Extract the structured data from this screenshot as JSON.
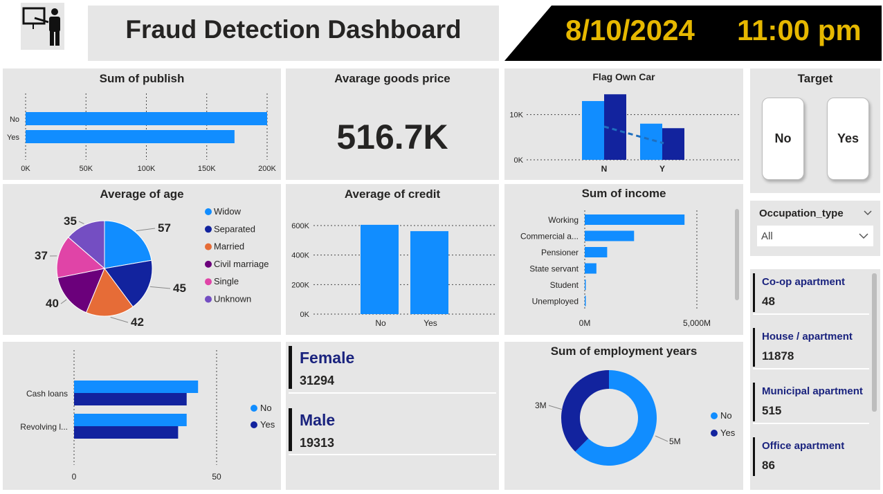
{
  "header": {
    "title": "Fraud Detection Dashboard",
    "date": "8/10/2024",
    "time": "11:00 pm",
    "icon": "presenter-icon"
  },
  "colors": {
    "light_blue": "#118DFF",
    "dark_blue": "#12239E",
    "orange": "#E66C37",
    "purple": "#6B007B",
    "pink": "#E044A7",
    "violet": "#744EC2",
    "banner_bg": "#000000",
    "banner_text": "#E6B800"
  },
  "publish_chart": {
    "title": "Sum of publish",
    "chart_data": {
      "type": "bar",
      "orientation": "horizontal",
      "categories": [
        "No",
        "Yes"
      ],
      "values": [
        200000,
        173000
      ],
      "xlim": [
        0,
        200000
      ],
      "tick_labels": [
        "0K",
        "50K",
        "100K",
        "150K",
        "200K"
      ]
    }
  },
  "goods_price": {
    "title": "Avarage goods price",
    "value": "516.7K"
  },
  "flag_car": {
    "title": "Flag Own Car",
    "chart_data": {
      "type": "bar",
      "categories": [
        "N",
        "Y"
      ],
      "series": [
        {
          "values": [
            13000,
            8000
          ]
        },
        {
          "values": [
            14500,
            7000
          ]
        }
      ],
      "ylim": [
        0,
        15000
      ],
      "tick_labels": [
        "0K",
        "10K"
      ],
      "trend_line": true
    }
  },
  "target": {
    "title": "Target",
    "buttons": [
      "No",
      "Yes"
    ]
  },
  "age_chart": {
    "title": "Average of age",
    "chart_data": {
      "type": "pie",
      "labels": [
        "Widow",
        "Separated",
        "Married",
        "Civil marriage",
        "Single",
        "Unknown"
      ],
      "values": [
        57,
        45,
        42,
        40,
        37,
        35
      ],
      "colors": [
        "#118DFF",
        "#12239E",
        "#E66C37",
        "#6B007B",
        "#E044A7",
        "#744EC2"
      ]
    }
  },
  "credit_chart": {
    "title": "Average of credit",
    "chart_data": {
      "type": "bar",
      "categories": [
        "No",
        "Yes"
      ],
      "values": [
        605000,
        562000
      ],
      "ylim": [
        0,
        600000
      ],
      "tick_labels": [
        "0K",
        "200K",
        "400K",
        "600K"
      ]
    }
  },
  "income_chart": {
    "title": "Sum of income",
    "chart_data": {
      "type": "bar",
      "orientation": "horizontal",
      "categories": [
        "Working",
        "Commercial a...",
        "Pensioner",
        "State servant",
        "Student",
        "Unemployed"
      ],
      "values": [
        4450,
        2200,
        1000,
        520,
        15,
        25
      ],
      "xlim": [
        0,
        5000
      ],
      "tick_labels": [
        "0M",
        "5,000M"
      ]
    }
  },
  "occupation_filter": {
    "label": "Occupation_type",
    "selected": "All"
  },
  "loan_chart": {
    "chart_data": {
      "type": "bar",
      "orientation": "horizontal",
      "categories": [
        "Cash loans",
        "Revolving l..."
      ],
      "series": [
        {
          "name": "No",
          "values": [
            43.5,
            39.5
          ]
        },
        {
          "name": "Yes",
          "values": [
            39.5,
            36.5
          ]
        }
      ],
      "xlim": [
        0,
        50
      ],
      "tick_labels": [
        "0",
        "50"
      ]
    },
    "legend": [
      "No",
      "Yes"
    ]
  },
  "gender_cards": [
    {
      "label": "Female",
      "value": "31294"
    },
    {
      "label": "Male",
      "value": "19313"
    }
  ],
  "employment_chart": {
    "title": "Sum of employment years",
    "chart_data": {
      "type": "pie",
      "variant": "donut",
      "labels": [
        "No",
        "Yes"
      ],
      "values": [
        5,
        3
      ],
      "data_labels": [
        "5M",
        "3M"
      ]
    },
    "legend": [
      "No",
      "Yes"
    ]
  },
  "housing_cards": [
    {
      "label": "Co-op apartment",
      "value": "48"
    },
    {
      "label": "House / apartment",
      "value": "11878"
    },
    {
      "label": "Municipal apartment",
      "value": "515"
    },
    {
      "label": "Office apartment",
      "value": "86"
    }
  ]
}
